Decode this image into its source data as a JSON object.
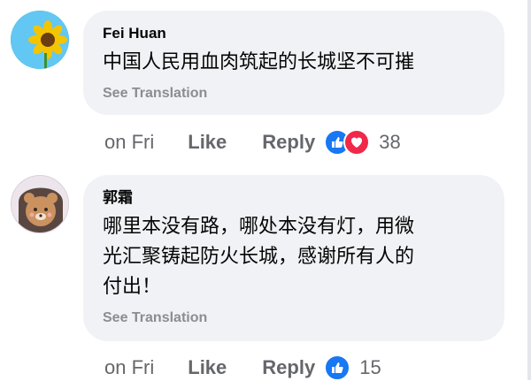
{
  "comments": [
    {
      "author": "Fei Huan",
      "avatar_icon": "sunflower-avatar",
      "text": "中国人民用血肉筑起的长城坚不可摧",
      "translate_label": "See Translation",
      "time": "on Fri",
      "like_label": "Like",
      "reply_label": "Reply",
      "reactions": [
        "like-reaction-icon",
        "love-reaction-icon"
      ],
      "reaction_count": "38"
    },
    {
      "author": "郭霜",
      "avatar_icon": "bear-avatar",
      "text_lines": [
        "哪里本没有路，哪处本没有灯，用微",
        "光汇聚铸起防火长城，感谢所有人的",
        "付出！"
      ],
      "translate_label": "See Translation",
      "time": "on Fri",
      "like_label": "Like",
      "reply_label": "Reply",
      "reactions": [
        "like-reaction-icon"
      ],
      "reaction_count": "15"
    }
  ],
  "colors": {
    "bubble": "#f0f2f5",
    "meta_text": "#65676b",
    "translate_text": "#8a8d91",
    "like_blue": "#1877f2",
    "love_red": "#f02849"
  }
}
